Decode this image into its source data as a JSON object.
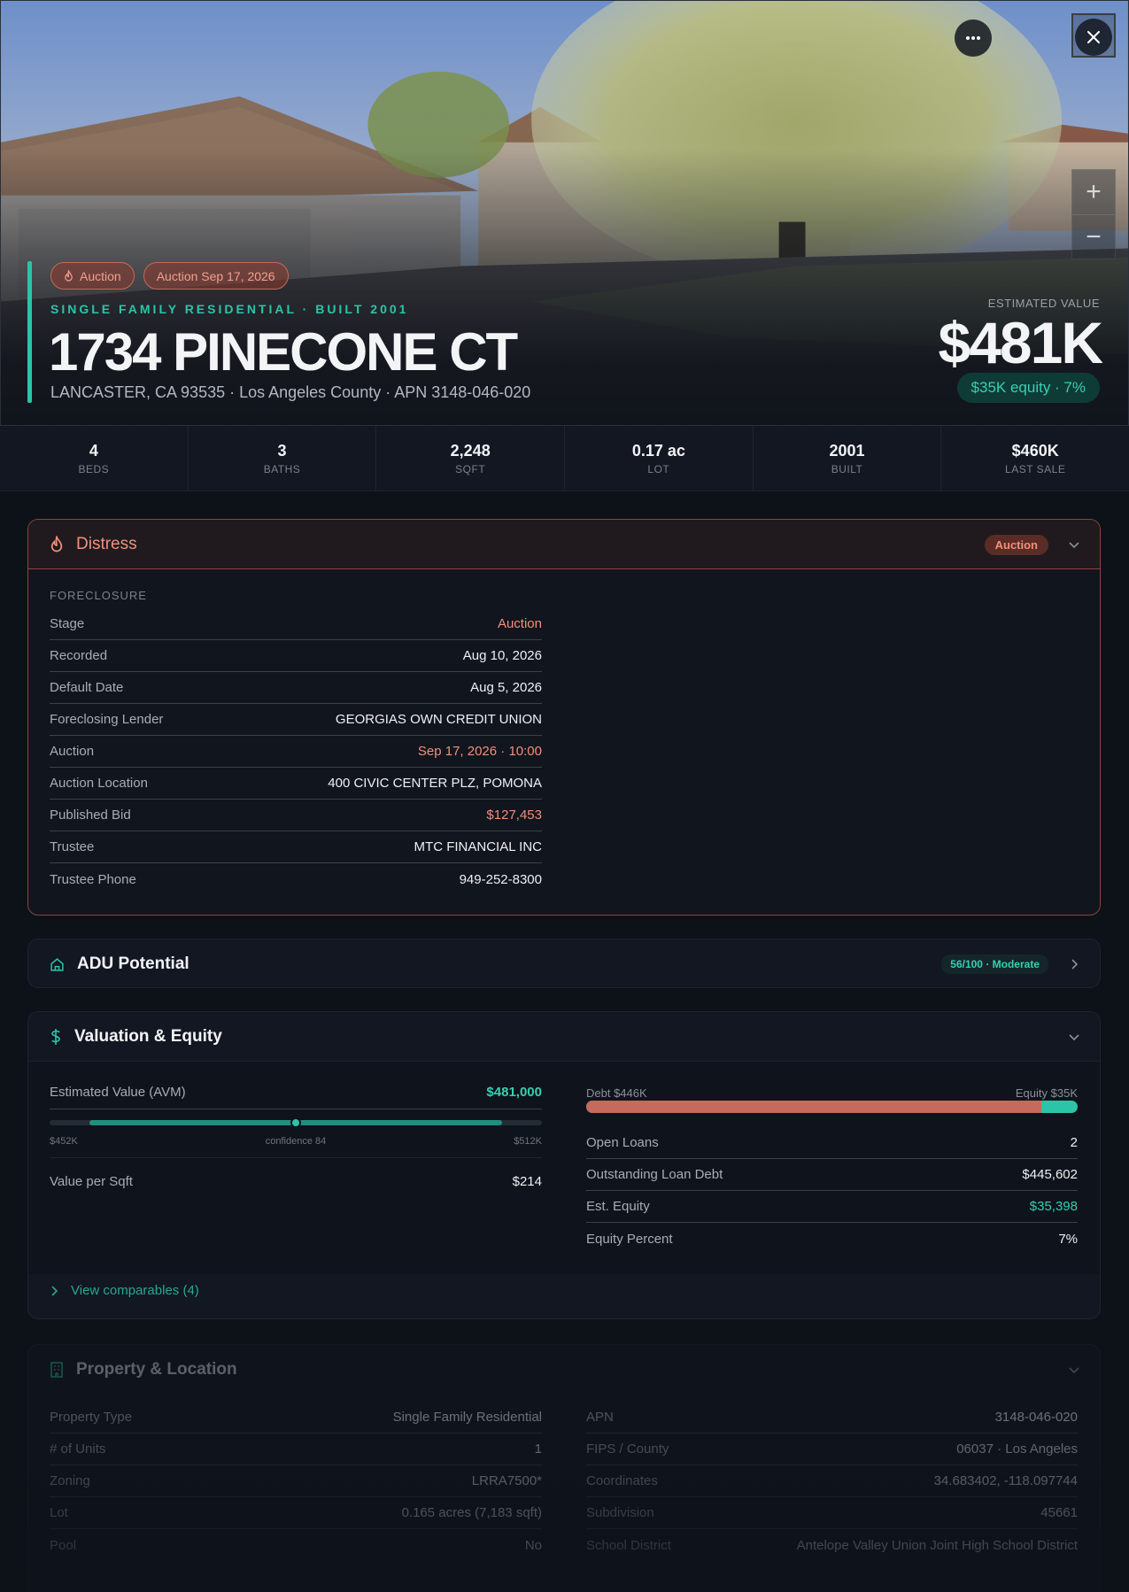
{
  "hero": {
    "chips": [
      {
        "label": "Auction",
        "icon": "flame-icon"
      },
      {
        "label": "Auction Sep 17, 2026"
      }
    ],
    "kicker": "SINGLE FAMILY RESIDENTIAL · BUILT 2001",
    "title": "1734 PINECONE CT",
    "subtitle": "LANCASTER, CA 93535 · Los Angeles County · APN 3148-046-020",
    "estimated_label": "ESTIMATED VALUE",
    "estimated_value": "$481K",
    "equity_pill": "$35K equity · 7%",
    "buttons": {
      "more_icon": "more-horizontal-icon",
      "close_icon": "close-icon"
    },
    "zoom": {
      "in": "+",
      "out": "−"
    }
  },
  "stats": [
    {
      "value": "4",
      "label": "BEDS"
    },
    {
      "value": "3",
      "label": "BATHS"
    },
    {
      "value": "2,248",
      "label": "SQFT"
    },
    {
      "value": "0.17 ac",
      "label": "LOT"
    },
    {
      "value": "2001",
      "label": "BUILT"
    },
    {
      "value": "$460K",
      "label": "LAST SALE"
    }
  ],
  "distress": {
    "title": "Distress",
    "badge": "Auction",
    "group_label": "FORECLOSURE",
    "rows": [
      {
        "k": "Stage",
        "v": "Auction"
      },
      {
        "k": "Recorded",
        "v": "Aug 10, 2026"
      },
      {
        "k": "Default Date",
        "v": "Aug 5, 2026"
      },
      {
        "k": "Foreclosing Lender",
        "v": "GEORGIAS OWN CREDIT UNION"
      },
      {
        "k": "Auction",
        "v": "Sep 17, 2026 · 10:00"
      },
      {
        "k": "Auction Location",
        "v": "400 CIVIC CENTER PLZ, POMONA"
      },
      {
        "k": "Published Bid",
        "v": "$127,453"
      },
      {
        "k": "Trustee",
        "v": "MTC FINANCIAL INC"
      },
      {
        "k": "Trustee Phone",
        "v": "949-252-8300"
      }
    ]
  },
  "adu": {
    "title": "ADU Potential",
    "score": "56/100 · Moderate"
  },
  "valuation": {
    "title": "Valuation & Equity",
    "avm_label": "Estimated Value (AVM)",
    "avm_value": "$481,000",
    "range_low": "$452K",
    "range_mid": "confidence 84",
    "range_high": "$512K",
    "confidence_fraction": 0.5,
    "vps_label": "Value per Sqft",
    "vps_value": "$214",
    "debt_label": "Debt $446K",
    "equity_label": "Equity $35K",
    "debt_fraction": 0.927,
    "rows": [
      {
        "k": "Open Loans",
        "v": "2"
      },
      {
        "k": "Outstanding Loan Debt",
        "v": "$445,602"
      },
      {
        "k": "Est. Equity",
        "v": "$35,398"
      },
      {
        "k": "Equity Percent",
        "v": "7%"
      }
    ],
    "comparables": "View comparables (4)"
  },
  "property": {
    "title": "Property & Location",
    "left": [
      {
        "k": "Property Type",
        "v": "Single Family Residential"
      },
      {
        "k": "# of Units",
        "v": "1"
      },
      {
        "k": "Zoning",
        "v": "LRRA7500*"
      },
      {
        "k": "Lot",
        "v": "0.165 acres (7,183 sqft)"
      },
      {
        "k": "Pool",
        "v": "No"
      }
    ],
    "right": [
      {
        "k": "APN",
        "v": "3148-046-020"
      },
      {
        "k": "FIPS / County",
        "v": "06037 · Los Angeles"
      },
      {
        "k": "Coordinates",
        "v": "34.683402, -118.097744"
      },
      {
        "k": "Subdivision",
        "v": "45661"
      },
      {
        "k": "School District",
        "v": "Antelope Valley Union Joint High School District"
      }
    ]
  },
  "colors": {
    "accent": "#2cc4a8",
    "distress": "#f0907c",
    "debt": "#c56a5c",
    "background": "#0d1118"
  }
}
